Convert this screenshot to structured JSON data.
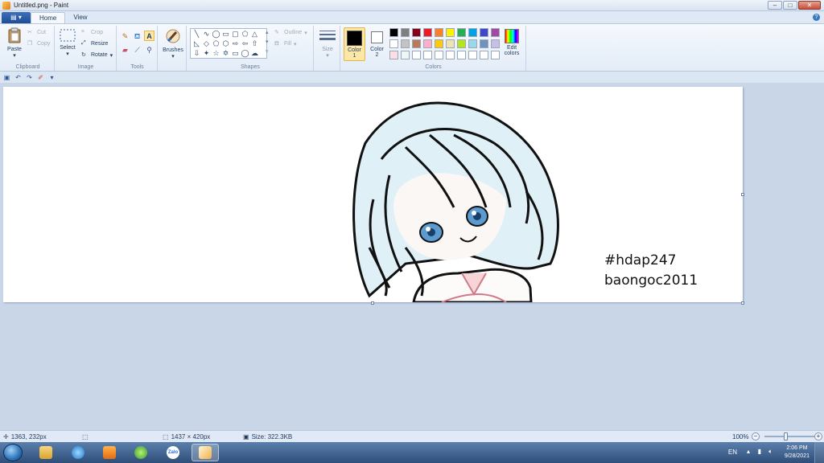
{
  "window": {
    "title": "Untitled.png - Paint",
    "minimize": "–",
    "maximize": "□",
    "close": "✕"
  },
  "ribbon_tabs": {
    "menu": "▤ ▾",
    "home": "Home",
    "view": "View",
    "help": "?"
  },
  "clipboard": {
    "paste": "Paste",
    "cut": "Cut",
    "copy": "Copy",
    "label": "Clipboard"
  },
  "image": {
    "select": "Select",
    "crop": "Crop",
    "resize": "Resize",
    "rotate": "Rotate",
    "label": "Image"
  },
  "tools": {
    "label": "Tools"
  },
  "brushes": {
    "label": "Brushes"
  },
  "shapes": {
    "outline": "Outline",
    "fill": "Fill",
    "label": "Shapes"
  },
  "size": {
    "label": "Size"
  },
  "colors": {
    "color1": "Color 1",
    "color2": "Color 2",
    "edit": "Edit colors",
    "label": "Colors",
    "color1_value": "#000000",
    "color2_value": "#ffffff",
    "palette_row1": [
      "#000000",
      "#7f7f7f",
      "#880015",
      "#ed1c24",
      "#ff7f27",
      "#fff200",
      "#22b14c",
      "#00a2e8",
      "#3f48cc",
      "#a349a4"
    ],
    "palette_row2": [
      "#ffffff",
      "#c3c3c3",
      "#b97a57",
      "#ffaec9",
      "#ffc90e",
      "#efe4b0",
      "#b5e61d",
      "#99d9ea",
      "#7092be",
      "#c8bfe7"
    ],
    "palette_row3": [
      "#ffdde6",
      "#eef6f8",
      "#ffffff",
      "#ffffff",
      "#ffffff",
      "#ffffff",
      "#ffffff",
      "#ffffff",
      "#ffffff",
      "#ffffff"
    ]
  },
  "canvas": {
    "watermark_line1": "#hdap247",
    "watermark_line2": "baongoc2011"
  },
  "status": {
    "cursor_pos": "1363, 232px",
    "image_size": "1437 × 420px",
    "file_size": "Size: 322.3KB",
    "zoom": "100%"
  },
  "taskbar": {
    "language": "EN",
    "time": "2:06 PM",
    "date": "9/28/2021",
    "zalo": "Zalo"
  }
}
